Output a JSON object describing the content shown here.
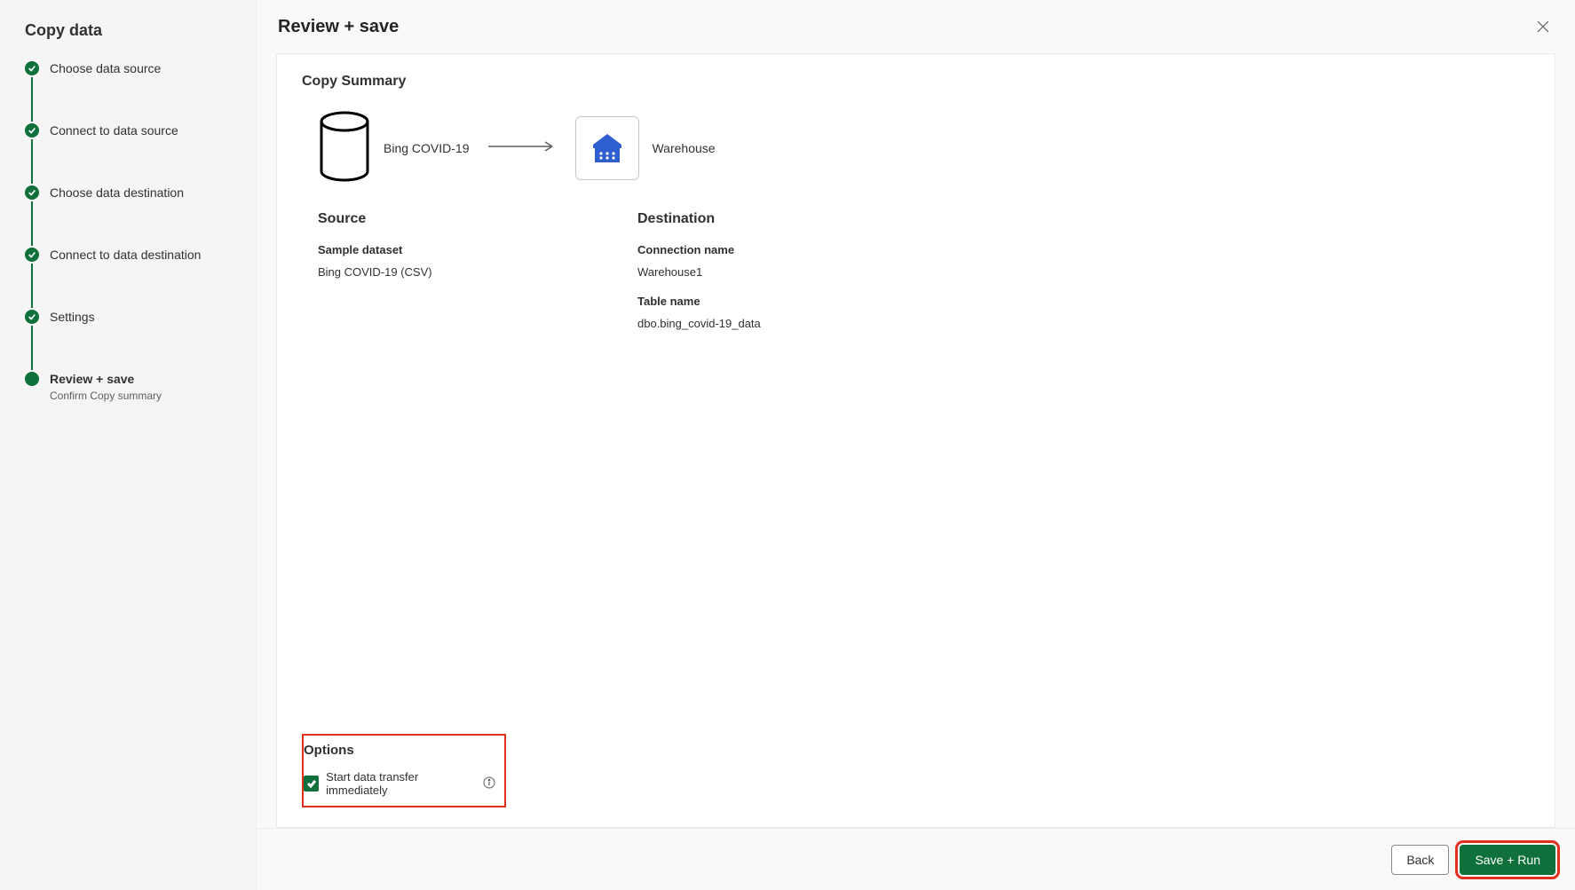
{
  "sidebar": {
    "title": "Copy data",
    "steps": [
      {
        "label": "Choose data source",
        "status": "done"
      },
      {
        "label": "Connect to data source",
        "status": "done"
      },
      {
        "label": "Choose data destination",
        "status": "done"
      },
      {
        "label": "Connect to data destination",
        "status": "done"
      },
      {
        "label": "Settings",
        "status": "done"
      },
      {
        "label": "Review + save",
        "status": "current",
        "sublabel": "Confirm Copy summary"
      }
    ]
  },
  "main": {
    "title": "Review + save",
    "summary_title": "Copy Summary",
    "source_node_label": "Bing COVID-19",
    "dest_node_label": "Warehouse",
    "source": {
      "heading": "Source",
      "fields": {
        "sample_dataset_label": "Sample dataset",
        "sample_dataset_value": "Bing COVID-19 (CSV)"
      }
    },
    "destination": {
      "heading": "Destination",
      "fields": {
        "conn_label": "Connection name",
        "conn_value": "Warehouse1",
        "table_label": "Table name",
        "table_value": "dbo.bing_covid-19_data"
      }
    },
    "options": {
      "heading": "Options",
      "checkbox_label": "Start data transfer immediately",
      "checked": true
    }
  },
  "footer": {
    "back": "Back",
    "save_run": "Save + Run"
  }
}
